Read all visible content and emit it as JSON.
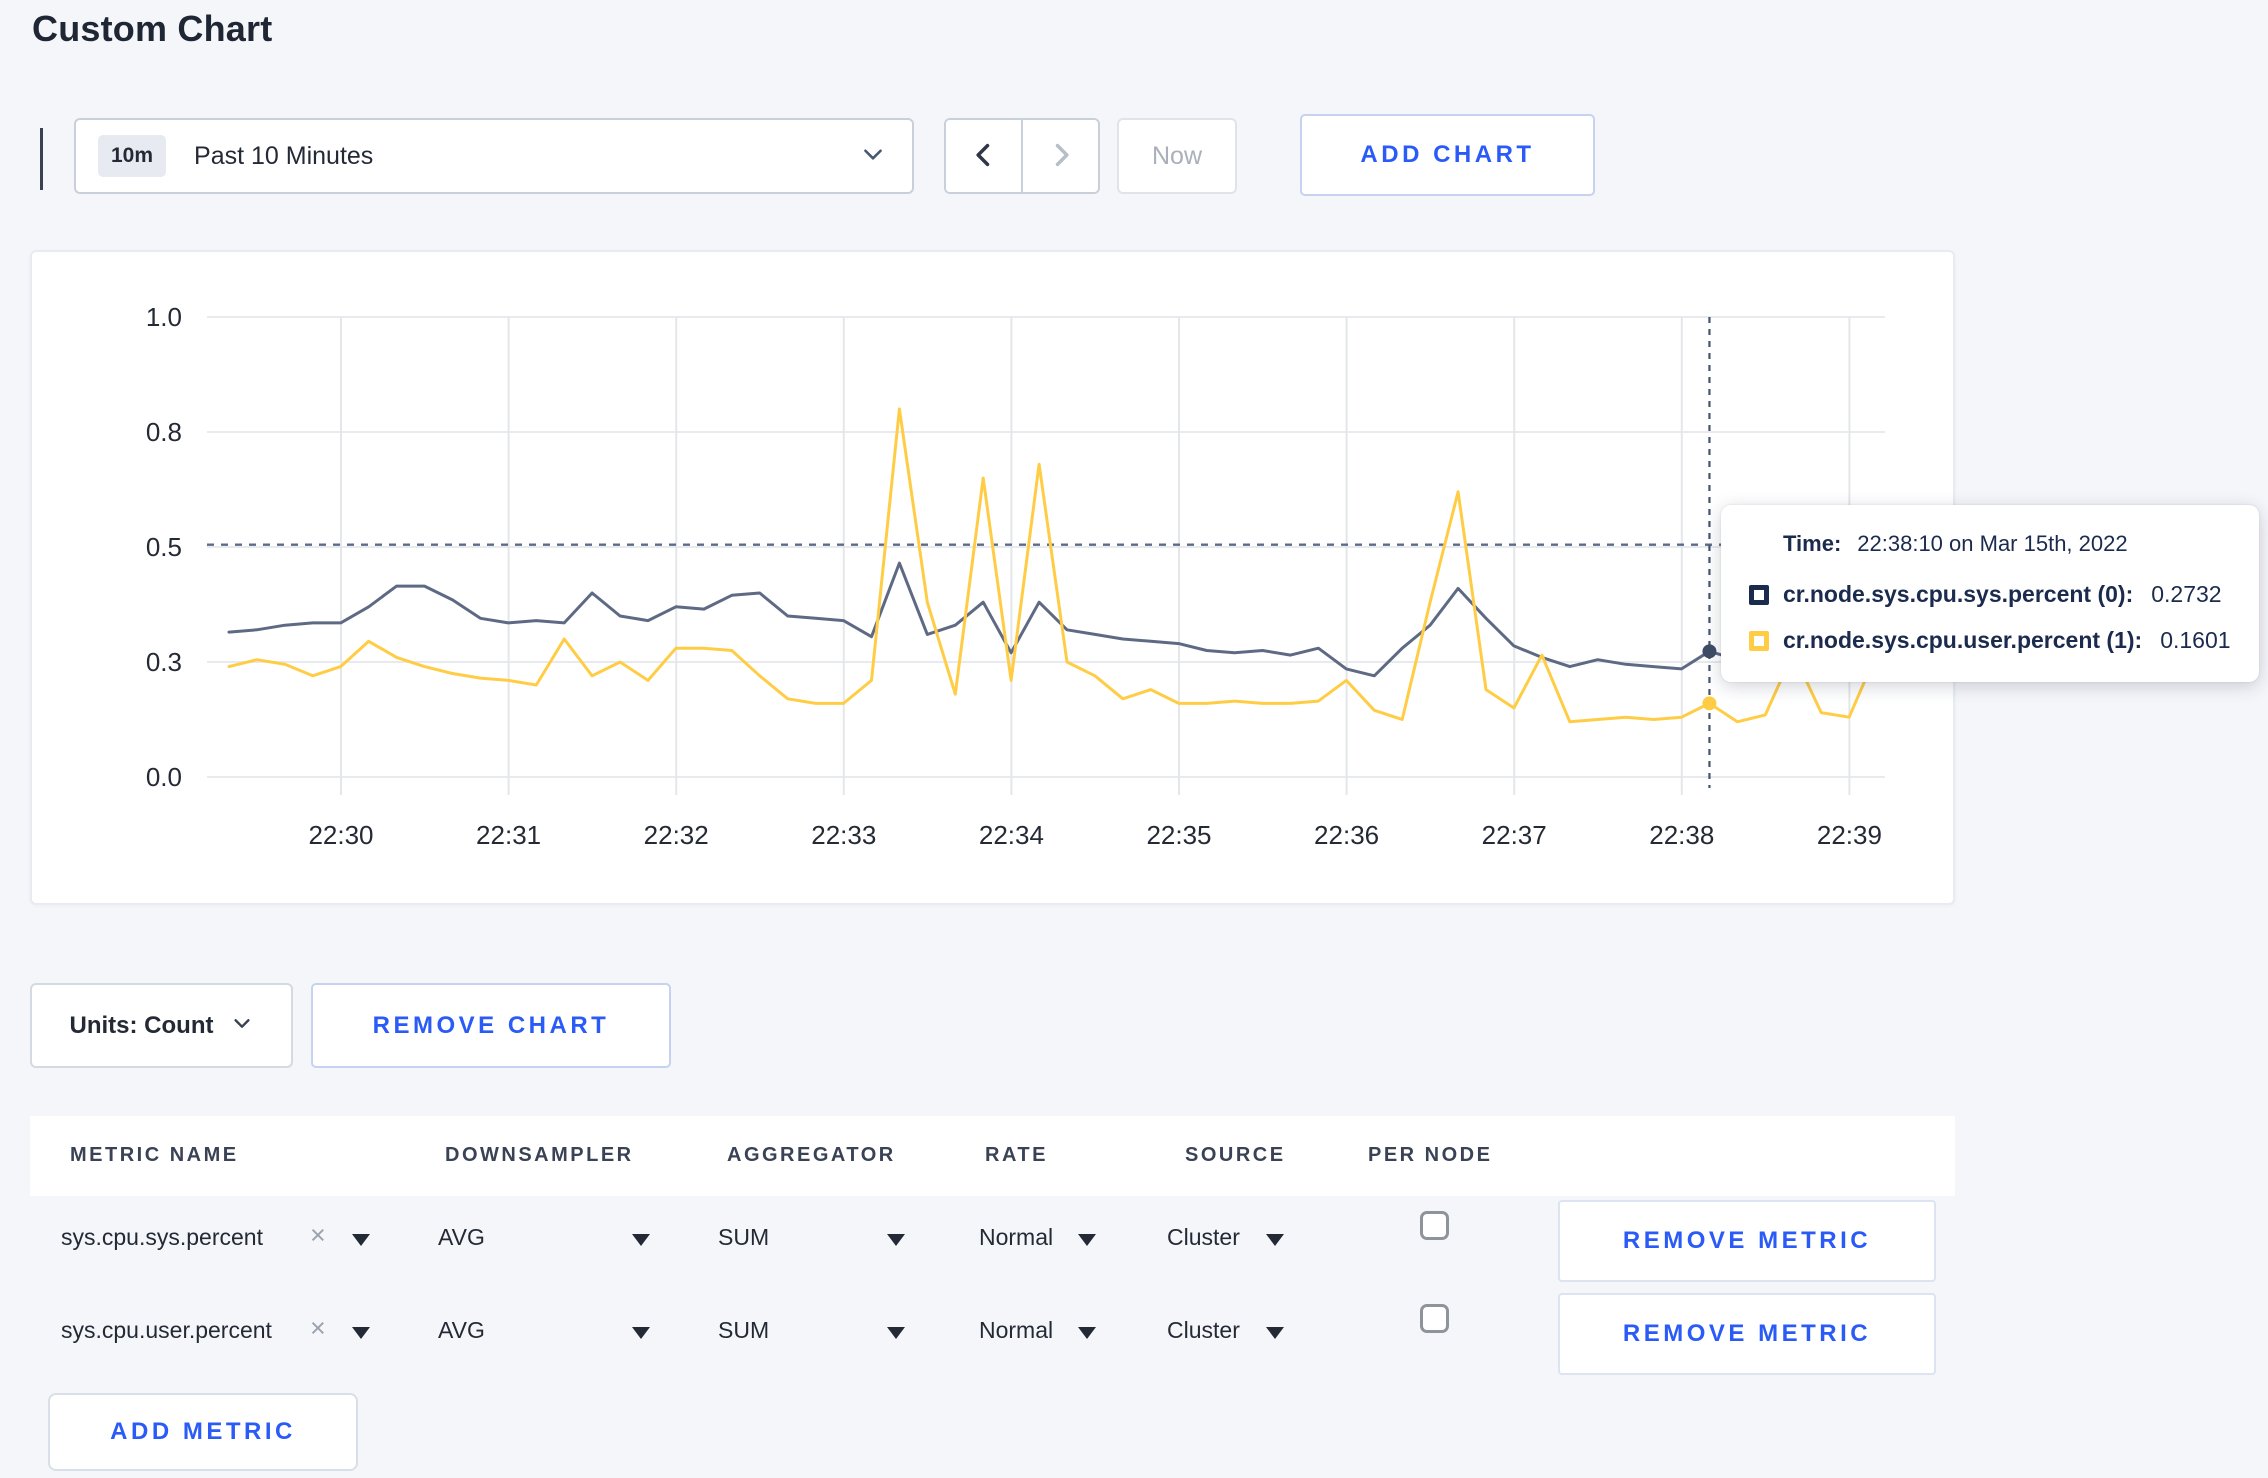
{
  "theme": {
    "accent_blue": "#2b5bf7",
    "page_bg": "#f5f6fa",
    "text_dark": "#242a35",
    "tooltip_navy": "#1b2b4e",
    "grid_line": "#e8eaee",
    "crosshair": "#44546e"
  },
  "page": {
    "title": "Custom Chart"
  },
  "toolbar": {
    "time_badge": "10m",
    "time_label": "Past 10 Minutes",
    "now_label": "Now",
    "add_chart_label": "ADD CHART"
  },
  "chart_data": {
    "type": "line",
    "title": "",
    "xlabel": "",
    "ylabel": "",
    "ylim": [
      0,
      1
    ],
    "grid": true,
    "y_tick_labels": [
      "0.0",
      "0.3",
      "0.5",
      "0.8",
      "1.0"
    ],
    "x_tick_labels": [
      "22:30",
      "22:31",
      "22:32",
      "22:33",
      "22:34",
      "22:35",
      "22:36",
      "22:37",
      "22:38",
      "22:39"
    ],
    "x_start_time": "22:29:20",
    "x_interval_seconds": 10,
    "threshold_dashed_line_y": 0.505,
    "crosshair_time": "22:38:10",
    "crosshair_index": 53,
    "series": [
      {
        "name": "cr.node.sys.cpu.sys.percent (0)",
        "color": "#5e6a84",
        "dot_color": "#3f4c66",
        "values": [
          0.315,
          0.32,
          0.33,
          0.335,
          0.335,
          0.37,
          0.415,
          0.415,
          0.385,
          0.345,
          0.335,
          0.34,
          0.335,
          0.4,
          0.35,
          0.34,
          0.37,
          0.365,
          0.395,
          0.4,
          0.35,
          0.345,
          0.34,
          0.305,
          0.465,
          0.31,
          0.33,
          0.38,
          0.27,
          0.38,
          0.32,
          0.31,
          0.3,
          0.295,
          0.29,
          0.275,
          0.27,
          0.275,
          0.265,
          0.28,
          0.235,
          0.22,
          0.28,
          0.33,
          0.41,
          0.345,
          0.285,
          0.26,
          0.24,
          0.255,
          0.245,
          0.24,
          0.235,
          0.2732,
          0.255,
          0.235,
          0.25,
          0.245,
          0.3,
          0.32
        ]
      },
      {
        "name": "cr.node.sys.cpu.user.percent (1)",
        "color": "#ffcd45",
        "dot_color": "#ffcd45",
        "values": [
          0.24,
          0.255,
          0.245,
          0.22,
          0.24,
          0.295,
          0.26,
          0.24,
          0.225,
          0.215,
          0.21,
          0.2,
          0.3,
          0.22,
          0.25,
          0.21,
          0.28,
          0.28,
          0.275,
          0.22,
          0.17,
          0.16,
          0.16,
          0.21,
          0.8,
          0.38,
          0.18,
          0.65,
          0.21,
          0.68,
          0.25,
          0.22,
          0.17,
          0.19,
          0.16,
          0.16,
          0.165,
          0.16,
          0.16,
          0.165,
          0.21,
          0.145,
          0.125,
          0.38,
          0.62,
          0.19,
          0.15,
          0.265,
          0.12,
          0.125,
          0.13,
          0.125,
          0.13,
          0.1601,
          0.12,
          0.135,
          0.27,
          0.14,
          0.13,
          0.27
        ]
      }
    ]
  },
  "tooltip": {
    "time_label": "Time:",
    "time_value": "22:38:10 on Mar 15th, 2022",
    "rows": [
      {
        "label": "cr.node.sys.cpu.sys.percent (0):",
        "value": "0.2732",
        "swatch_color": "#1b2b4e"
      },
      {
        "label": "cr.node.sys.cpu.user.percent (1):",
        "value": "0.1601",
        "swatch_color": "#ffcd45"
      }
    ]
  },
  "chart_controls": {
    "units_label": "Units: Count",
    "remove_chart_label": "REMOVE CHART"
  },
  "metrics_table": {
    "headers": [
      "METRIC NAME",
      "DOWNSAMPLER",
      "AGGREGATOR",
      "RATE",
      "SOURCE",
      "PER NODE"
    ],
    "rows": [
      {
        "metric": "sys.cpu.sys.percent",
        "downsampler": "AVG",
        "aggregator": "SUM",
        "rate": "Normal",
        "source": "Cluster",
        "per_node_checked": false,
        "remove_label": "REMOVE METRIC"
      },
      {
        "metric": "sys.cpu.user.percent",
        "downsampler": "AVG",
        "aggregator": "SUM",
        "rate": "Normal",
        "source": "Cluster",
        "per_node_checked": false,
        "remove_label": "REMOVE METRIC"
      }
    ],
    "add_metric_label": "ADD METRIC"
  }
}
